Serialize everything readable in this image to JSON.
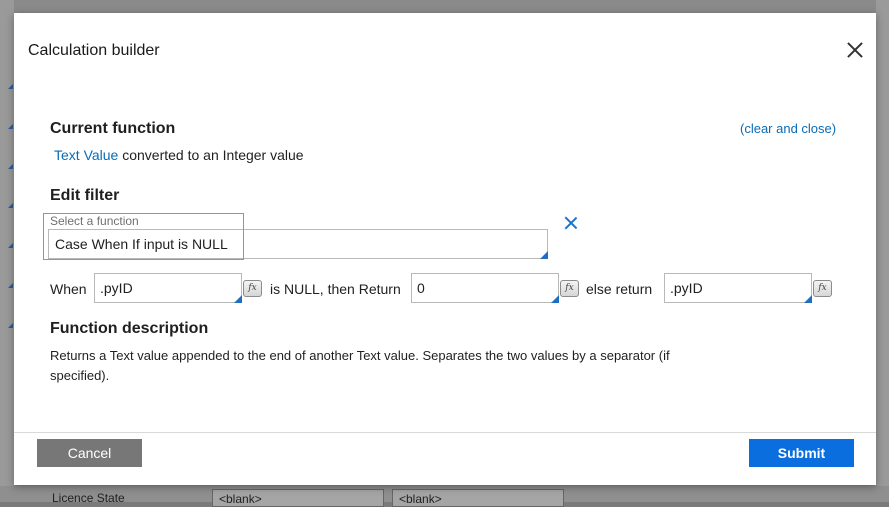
{
  "dialog": {
    "title": "Calculation builder"
  },
  "current_function": {
    "heading": "Current function",
    "link_text": "Text Value",
    "suffix_text": "converted to an Integer value",
    "clear_link": "(clear and close)"
  },
  "edit_filter": {
    "heading": "Edit filter",
    "select_label": "Select a function",
    "selected_function": "Case When If input is NULL"
  },
  "params": {
    "when_label": "When",
    "when_value": ".pyID",
    "is_null_label": "is NULL, then Return",
    "return_value": "0",
    "else_label": "else return",
    "else_value": ".pyID",
    "fx_label": "fx"
  },
  "function_description": {
    "heading": "Function description",
    "text": "Returns a Text value appended to the end of another Text value. Separates the two values by a separator (if specified)."
  },
  "footer": {
    "cancel_label": "Cancel",
    "submit_label": "Submit"
  },
  "background": {
    "row_label": "Licence State",
    "cell_1": "<blank>",
    "cell_2": "<blank>"
  },
  "colors": {
    "link": "#0a6bb5",
    "submit": "#0a6ede",
    "cancel": "#777777",
    "highlight": "#ea5bea"
  }
}
